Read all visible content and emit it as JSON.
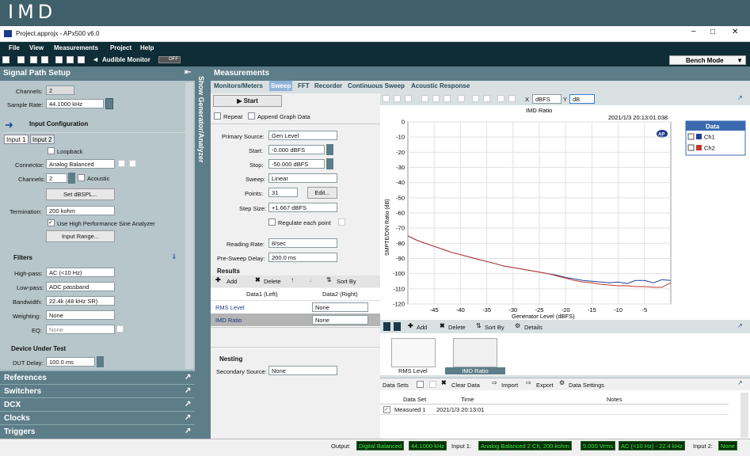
{
  "banner": "IMD",
  "window": {
    "title": "Project.approjx - APx500 v6.0"
  },
  "menu": [
    "File",
    "View",
    "Measurements",
    "Project",
    "Help"
  ],
  "toolbar": {
    "audible_monitor": "Audible Monitor",
    "off": "OFF",
    "bench_mode": "Bench Mode"
  },
  "signal_path": {
    "title": "Signal Path Setup",
    "channels_label": "Channels:",
    "channels": "2",
    "sample_rate_label": "Sample Rate:",
    "sample_rate": "44.1000 kHz",
    "input_config": "Input Configuration",
    "tabs": [
      "Input 1",
      "Input 2"
    ],
    "loopback": "Loopback",
    "connector_label": "Connector:",
    "connector": "Analog Balanced",
    "ch_label": "Channels:",
    "ch": "2",
    "acoustic": "Acoustic",
    "set_dbspl": "Set dBSPL...",
    "termination_label": "Termination:",
    "termination": "200 kohm",
    "use_hp": "Use High Performance Sine Analyzer",
    "input_range": "Input Range...",
    "filters": "Filters",
    "highpass_label": "High-pass:",
    "highpass": "AC (<10 Hz)",
    "lowpass_label": "Low-pass:",
    "lowpass": "ADC passband",
    "bandwidth_label": "Bandwidth:",
    "bandwidth": "22.4k (48 kHz SR)",
    "weighting_label": "Weighting:",
    "weighting": "None",
    "eq_label": "EQ:",
    "eq": "None",
    "dut": "Device Under Test",
    "dut_delay_label": "DUT Delay:",
    "dut_delay": "100.0 ms",
    "sections": [
      "References",
      "Switchers",
      "DCX",
      "Clocks",
      "Triggers"
    ]
  },
  "side_tab": "Show Generator/Analyzer",
  "measurements": {
    "title": "Measurements",
    "tabs": [
      "Monitors/Meters",
      "Sweep",
      "FFT",
      "Recorder",
      "Continuous Sweep",
      "Acoustic Response"
    ],
    "active_tab": "Sweep",
    "start": "Start",
    "repeat": "Repeat",
    "append": "Append Graph Data",
    "primary_source_label": "Primary Source:",
    "primary_source": "Gen Level",
    "start_label": "Start:",
    "start_val": "-0.000 dBFS",
    "stop_label": "Stop:",
    "stop_val": "-50.000 dBFS",
    "sweep_label": "Sweep:",
    "sweep_val": "Linear",
    "points_label": "Points:",
    "points": "31",
    "edit": "Edit...",
    "stepsize_label": "Step Size:",
    "stepsize": "+1.667 dBFS",
    "regulate": "Regulate each point",
    "reading_rate_label": "Reading Rate:",
    "reading_rate": "8/sec",
    "presweep_label": "Pre-Sweep Delay:",
    "presweep": "200.0 ms",
    "results": "Results",
    "add": "Add",
    "delete": "Delete",
    "sortby": "Sort By",
    "results_cols": [
      "Data1 (Left)",
      "Data2 (Right)"
    ],
    "results_rows": [
      {
        "name": "RMS Level",
        "value": "None"
      },
      {
        "name": "IMD Ratio",
        "value": "None"
      }
    ],
    "nesting": "Nesting",
    "secondary_label": "Secondary Source:",
    "secondary": "None"
  },
  "graph_toolbar": {
    "x_label": "X",
    "x_unit": "dBFS",
    "y_label": "Y",
    "y_unit": "dB"
  },
  "chart_data": {
    "type": "line",
    "title": "IMD Ratio",
    "timestamp": "2021/1/3 20:13:01.038",
    "logo": "AP",
    "xlabel": "Generator Level (dBFS)",
    "ylabel": "SMPTE/DIN Ratio (dB)",
    "xlim": [
      -50,
      0
    ],
    "ylim": [
      -120,
      0
    ],
    "xticks": [
      -45,
      -40,
      -35,
      -30,
      -25,
      -20,
      -15,
      -10,
      -5
    ],
    "yticks": [
      0,
      -10,
      -20,
      -30,
      -40,
      -50,
      -60,
      -70,
      -80,
      -90,
      -100,
      -110,
      -120
    ],
    "grid": true,
    "legend_title": "Data",
    "legend_position": "right",
    "series": [
      {
        "name": "Ch1",
        "color": "#1f3f9a",
        "x": [
          -50,
          -48.3,
          -46.7,
          -45,
          -43.3,
          -41.7,
          -40,
          -38.3,
          -36.7,
          -35,
          -33.3,
          -31.7,
          -30,
          -28.3,
          -26.7,
          -25,
          -23.3,
          -21.7,
          -20,
          -18.3,
          -16.7,
          -15,
          -13.3,
          -11.7,
          -10,
          -8.3,
          -6.7,
          -5,
          -3.3,
          -1.7,
          0
        ],
        "y": [
          -75,
          -78,
          -80,
          -82,
          -84,
          -86,
          -87.5,
          -89,
          -90.5,
          -92,
          -93.5,
          -95,
          -96,
          -97,
          -98,
          -99,
          -100,
          -101,
          -102.5,
          -103.5,
          -104.5,
          -105,
          -105.5,
          -106,
          -105.5,
          -106.5,
          -104.5,
          -104.5,
          -106,
          -104,
          -104.5
        ]
      },
      {
        "name": "Ch2",
        "color": "#c0392b",
        "x": [
          -50,
          -48.3,
          -46.7,
          -45,
          -43.3,
          -41.7,
          -40,
          -38.3,
          -36.7,
          -35,
          -33.3,
          -31.7,
          -30,
          -28.3,
          -26.7,
          -25,
          -23.3,
          -21.7,
          -20,
          -18.3,
          -16.7,
          -15,
          -13.3,
          -11.7,
          -10,
          -8.3,
          -6.7,
          -5,
          -3.3,
          -1.7,
          0
        ],
        "y": [
          -75,
          -78,
          -80,
          -82,
          -84,
          -86,
          -87.5,
          -89,
          -90.5,
          -92,
          -93.5,
          -95,
          -96,
          -97,
          -98,
          -99,
          -100,
          -101.5,
          -103,
          -104.5,
          -105.5,
          -106,
          -107,
          -107.5,
          -108,
          -108,
          -108.5,
          -108.5,
          -109,
          -109,
          -106
        ]
      }
    ]
  },
  "bottom_toolbar": {
    "add": "Add",
    "delete": "Delete",
    "sortby": "Sort By",
    "details": "Details"
  },
  "thumbnails": [
    "RMS Level",
    "IMD Ratio"
  ],
  "data_sets": {
    "title": "Data Sets",
    "clear": "Clear Data",
    "import": "Import",
    "export": "Export",
    "settings": "Data Settings",
    "cols": [
      "Data Set",
      "Time",
      "Notes"
    ],
    "rows": [
      {
        "name": "Measured 1",
        "time": "2021/1/3 20:13:01",
        "notes": ""
      }
    ]
  },
  "status": {
    "output_label": "Output:",
    "output": "Digital Balanced",
    "output_rate": "44.1000 kHz",
    "input1_label": "Input 1:",
    "input1": "Analog Balanced 2 Ch, 200 kohm",
    "input1_range": "5.000 Vrms",
    "input1_filter": "AC (<10 Hz) - 22.4 kHz",
    "input2_label": "Input 2:",
    "input2": "None"
  }
}
